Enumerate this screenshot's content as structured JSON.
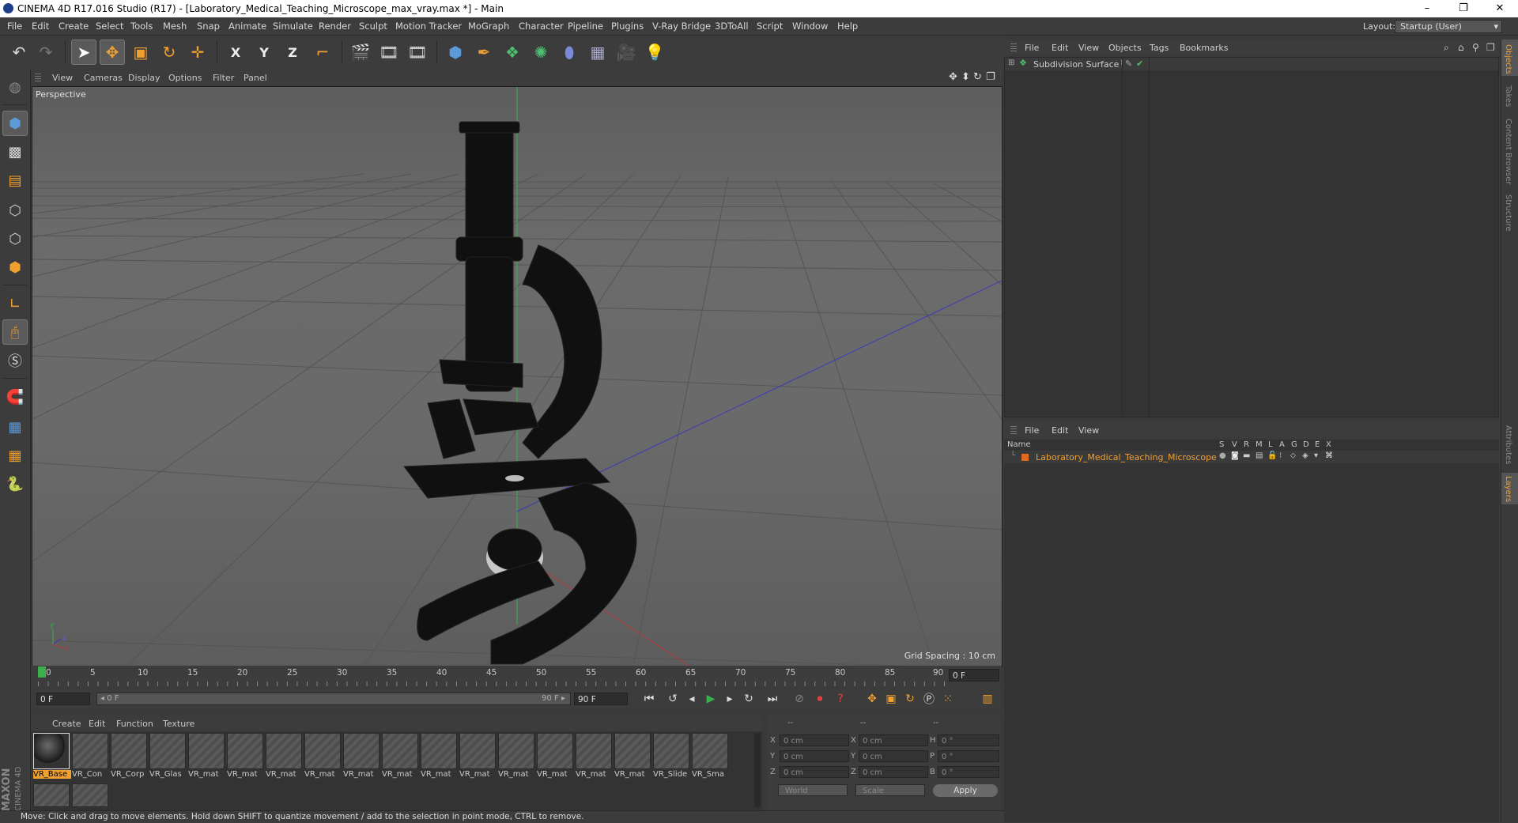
{
  "window": {
    "title": "CINEMA 4D R17.016 Studio (R17) - [Laboratory_Medical_Teaching_Microscope_max_vray.max *] - Main",
    "controls": [
      "–",
      "❐",
      "✕"
    ]
  },
  "menu": {
    "items": [
      "File",
      "Edit",
      "Create",
      "Select",
      "Tools",
      "Mesh",
      "Snap",
      "Animate",
      "Simulate",
      "Render",
      "Sculpt",
      "Motion Tracker",
      "MoGraph",
      "Character",
      "Pipeline",
      "Plugins",
      "V-Ray Bridge",
      "3DToAll",
      "Script",
      "Window",
      "Help"
    ],
    "layout_label": "Layout:",
    "layout_value": "Startup (User)"
  },
  "toolbar": {
    "axis_x": "X",
    "axis_y": "Y",
    "axis_z": "Z"
  },
  "viewport": {
    "menu": [
      "View",
      "Cameras",
      "Display",
      "Options",
      "Filter",
      "Panel"
    ],
    "label": "Perspective",
    "grid_spacing": "Grid Spacing : 10 cm"
  },
  "timeline": {
    "ticks": [
      "0",
      "5",
      "10",
      "15",
      "20",
      "25",
      "30",
      "35",
      "40",
      "45",
      "50",
      "55",
      "60",
      "65",
      "70",
      "75",
      "80",
      "85",
      "90"
    ],
    "current_frame": "0 F",
    "start": "0 F",
    "slider_start": "◂ 0 F",
    "slider_end": "90 F ▸",
    "end": "90 F"
  },
  "materials": {
    "menu": [
      "Create",
      "Edit",
      "Function",
      "Texture"
    ],
    "items": [
      "VR_Base",
      "VR_Con",
      "VR_Corp",
      "VR_Glas",
      "VR_mat",
      "VR_mat",
      "VR_mat",
      "VR_mat",
      "VR_mat",
      "VR_mat",
      "VR_mat",
      "VR_mat",
      "VR_mat",
      "VR_mat",
      "VR_mat",
      "VR_mat",
      "VR_Slide",
      "VR_Sma"
    ]
  },
  "coordinates": {
    "header": [
      "--",
      "--",
      "--"
    ],
    "rows": [
      {
        "l1": "X",
        "v1": "0 cm",
        "l2": "X",
        "v2": "0 cm",
        "l3": "H",
        "v3": "0 °"
      },
      {
        "l1": "Y",
        "v1": "0 cm",
        "l2": "Y",
        "v2": "0 cm",
        "l3": "P",
        "v3": "0 °"
      },
      {
        "l1": "Z",
        "v1": "0 cm",
        "l2": "Z",
        "v2": "0 cm",
        "l3": "B",
        "v3": "0 °"
      }
    ],
    "mode": "World",
    "scale": "Scale",
    "apply": "Apply"
  },
  "status": "Move: Click and drag to move elements. Hold down SHIFT to quantize movement / add to the selection in point mode, CTRL to remove.",
  "objects": {
    "menu": [
      "File",
      "Edit",
      "View",
      "Objects",
      "Tags",
      "Bookmarks"
    ],
    "items": [
      {
        "name": "Subdivision Surface"
      }
    ]
  },
  "layers": {
    "menu": [
      "File",
      "Edit",
      "View"
    ],
    "columns": [
      "Name",
      "S",
      "V",
      "R",
      "M",
      "L",
      "A",
      "G",
      "D",
      "E",
      "X"
    ],
    "items": [
      {
        "name": "Laboratory_Medical_Teaching_Microscope",
        "color": "#e06a20"
      }
    ]
  },
  "right_tabs": [
    "Objects",
    "Takes",
    "Content Browser",
    "Structure",
    "Attributes",
    "Layers"
  ],
  "branding": {
    "maxon": "MAXON",
    "product": "CINEMA 4D"
  },
  "colors": {
    "accent": "#f0a030",
    "active_blue": "#5a9ad8",
    "layer_orange": "#e06a20"
  }
}
